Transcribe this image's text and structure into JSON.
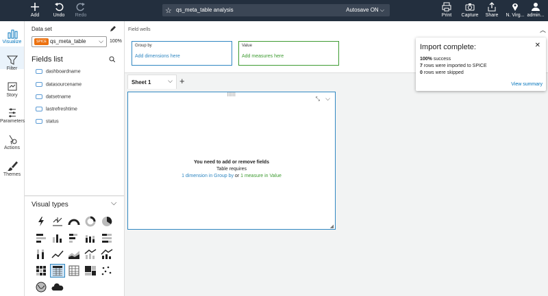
{
  "topbar": {
    "add": "Add",
    "undo": "Undo",
    "redo": "Redo",
    "analysis_name": "qs_meta_table analysis",
    "autosave": "Autosave ON",
    "print": "Print",
    "capture": "Capture",
    "share": "Share",
    "region": "N. Virg...",
    "user": "admin..."
  },
  "leftnav": {
    "items": [
      "Visualize",
      "Filter",
      "Story",
      "Parameters",
      "Actions",
      "Themes"
    ],
    "active_color": "#0073bb"
  },
  "panel": {
    "dataset_label": "Data set",
    "spice_badge": "SPICE",
    "dataset_name": "qs_meta_table",
    "dataset_pct": "100%",
    "fields_title": "Fields list",
    "fields": [
      "dashboardname",
      "datasourcename",
      "datsetname",
      "lastrefreshtime",
      "status"
    ],
    "visual_types_title": "Visual types"
  },
  "main": {
    "field_wells_title": "Field wells",
    "group_by_title": "Group by",
    "group_by_placeholder": "Add dimensions here",
    "value_title": "Value",
    "value_placeholder": "Add measures here",
    "sheet_tab": "Sheet 1",
    "canvas": {
      "line1": "You need to add or remove fields",
      "line2": "Table requires",
      "req_dim": "1 dimension in Group by",
      "req_or": " or ",
      "req_measure": "1 measure in Value"
    }
  },
  "toast": {
    "title": "Import complete:",
    "line1_bold": "100%",
    "line1_rest": " success",
    "line2_bold": "7",
    "line2_rest": " rows were imported to SPICE",
    "line3_bold": "0",
    "line3_rest": " rows were skipped",
    "view_summary": "View summary"
  },
  "colors": {
    "topbar": "#232f3e",
    "accent_blue": "#2e86c1",
    "accent_green": "#3c9a2f",
    "spice_orange": "#ec7211"
  }
}
